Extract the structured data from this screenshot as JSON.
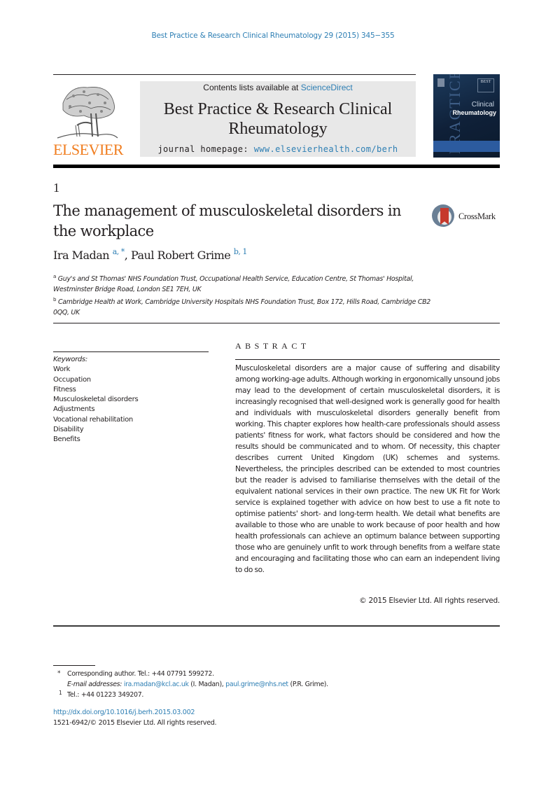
{
  "journal_reference": "Best Practice & Research Clinical Rheumatology 29 (2015) 345−355",
  "masthead": {
    "publisher_logo_text": "ELSEVIER",
    "contents_prefix": "Contents lists available at ",
    "contents_link": "ScienceDirect",
    "journal_title_line1": "Best Practice & Research Clinical",
    "journal_title_line2": "Rheumatology",
    "homepage_prefix": "journal homepage: ",
    "homepage_link": "www.elsevierhealth.com/berh",
    "cover": {
      "best_label": "BEST",
      "practice_label": "PRACTICE",
      "clinical_label": "Clinical",
      "rheumatology_label": "Rheumatology"
    }
  },
  "article": {
    "chapter_number": "1",
    "title": "The management of musculoskeletal disorders in the workplace",
    "crossmark_label": "CrossMark",
    "authors": [
      {
        "name": "Ira Madan",
        "marks": "a, *"
      },
      {
        "name": "Paul Robert Grime",
        "marks": "b, 1"
      }
    ],
    "affiliations": [
      {
        "mark": "a",
        "text": "Guy's and St Thomas' NHS Foundation Trust, Occupational Health Service, Education Centre, St Thomas' Hospital, Westminster Bridge Road, London SE1 7EH, UK"
      },
      {
        "mark": "b",
        "text": "Cambridge Health at Work, Cambridge University Hospitals NHS Foundation Trust, Box 172, Hills Road, Cambridge CB2 0QQ, UK"
      }
    ]
  },
  "keywords": {
    "title": "Keywords:",
    "items": [
      "Work",
      "Occupation",
      "Fitness",
      "Musculoskeletal disorders",
      "Adjustments",
      "Vocational rehabilitation",
      "Disability",
      "Benefits"
    ]
  },
  "abstract": {
    "heading": "ABSTRACT",
    "body": "Musculoskeletal disorders are a major cause of suffering and disability among working-age adults. Although working in ergonomically unsound jobs may lead to the development of certain musculoskeletal disorders, it is increasingly recognised that well-designed work is generally good for health and individuals with musculoskeletal disorders generally benefit from working. This chapter explores how health-care professionals should assess patients' fitness for work, what factors should be considered and how the results should be communicated and to whom. Of necessity, this chapter describes current United Kingdom (UK) schemes and systems. Nevertheless, the principles described can be extended to most countries but the reader is advised to familiarise themselves with the detail of the equivalent national services in their own practice. The new UK Fit for Work service is explained together with advice on how best to use a fit note to optimise patients' short- and long-term health. We detail what benefits are available to those who are unable to work because of poor health and how health professionals can achieve an optimum balance between supporting those who are genuinely unfit to work through benefits from a welfare state and encouraging and facilitating those who can earn an independent living to do so.",
    "copyright": "© 2015 Elsevier Ltd. All rights reserved."
  },
  "footnotes": {
    "corresponding_mark": "*",
    "corresponding_text": "Corresponding author. Tel.: +44 07791 599272.",
    "email_label": "E-mail addresses:",
    "email1": "ira.madan@kcl.ac.uk",
    "email1_name": " (I. Madan), ",
    "email2": "paul.grime@nhs.net",
    "email2_name": " (P.R. Grime).",
    "note1_mark": "1",
    "note1_text": "Tel.: +44 01223 349207."
  },
  "doi_link": "http://dx.doi.org/10.1016/j.berh.2015.03.002",
  "issn_line": "1521-6942/© 2015 Elsevier Ltd. All rights reserved."
}
